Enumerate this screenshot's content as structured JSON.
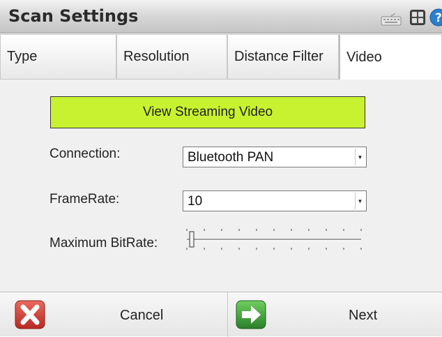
{
  "window": {
    "title": "Scan Settings"
  },
  "header_icons": [
    "keyboard-icon",
    "grid-apps-icon",
    "help-icon"
  ],
  "tabs": [
    {
      "label": "Type",
      "active": false
    },
    {
      "label": "Resolution",
      "active": false
    },
    {
      "label": "Distance Filter",
      "active": false
    },
    {
      "label": "Video",
      "active": true
    }
  ],
  "video": {
    "stream_button_label": "View Streaming Video",
    "connection": {
      "label": "Connection:",
      "value": "Bluetooth PAN"
    },
    "framerate": {
      "label": "FrameRate:",
      "value": "10"
    },
    "max_bitrate": {
      "label": "Maximum BitRate:",
      "slider_position": 0.04
    }
  },
  "footer": {
    "cancel_label": "Cancel",
    "next_label": "Next"
  },
  "colors": {
    "stream_button": "#c8f230",
    "cancel_icon": "#d0342c",
    "next_icon": "#3a9a3a"
  }
}
